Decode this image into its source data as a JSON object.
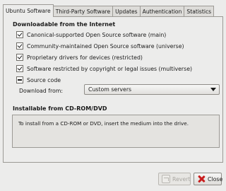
{
  "tabs": [
    {
      "label": "Ubuntu Software",
      "active": true
    },
    {
      "label": "Third-Party Software",
      "active": false
    },
    {
      "label": "Updates",
      "active": false
    },
    {
      "label": "Authentication",
      "active": false
    },
    {
      "label": "Statistics",
      "active": false
    }
  ],
  "internet": {
    "title": "Downloadable from the Internet",
    "options": [
      {
        "label": "Canonical-supported Open Source software (main)",
        "state": "checked"
      },
      {
        "label": "Community-maintained Open Source software (universe)",
        "state": "checked"
      },
      {
        "label": "Proprietary drivers for devices (restricted)",
        "state": "checked"
      },
      {
        "label": "Software restricted by copyright or legal issues (multiverse)",
        "state": "checked"
      },
      {
        "label": "Source code",
        "state": "partial"
      }
    ],
    "download_from_label": "Download from:",
    "download_from_value": "Custom servers"
  },
  "cdrom": {
    "title": "Installable from CD-ROM/DVD",
    "message": "To install from a CD-ROM or DVD, insert the medium into the drive."
  },
  "buttons": {
    "revert_label": "Revert",
    "close_label": "Close"
  }
}
